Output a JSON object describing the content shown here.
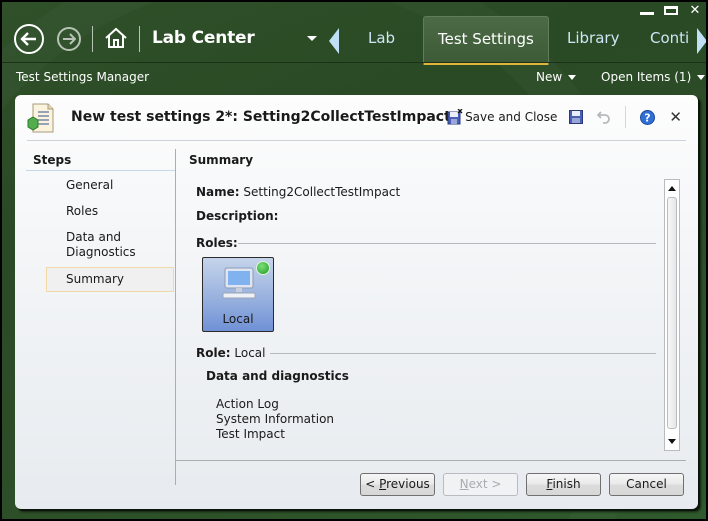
{
  "window": {
    "controls": {
      "minimize": "minimize-icon",
      "maximize": "maximize-icon",
      "close": "✕"
    }
  },
  "nav": {
    "back_icon": "back-arrow-icon",
    "forward_icon": "forward-arrow-icon",
    "home_icon": "home-icon",
    "app_title": "Lab Center",
    "tabs": [
      {
        "label": "Lab",
        "active": false
      },
      {
        "label": "Test Settings",
        "active": true
      },
      {
        "label": "Library",
        "active": false
      },
      {
        "label": "Conti",
        "active": false
      }
    ],
    "active_tab_underline_color": "#e1b53a"
  },
  "subbar": {
    "breadcrumb": "Test Settings Manager",
    "new_label": "New",
    "open_items_label": "Open Items (1)"
  },
  "dialog": {
    "title": "New test settings 2*: Setting2CollectTestImpact",
    "toolbar": {
      "save_and_close": "Save and Close",
      "save_icon": "save-icon",
      "undo_icon": "undo-icon",
      "help_icon": "help-icon",
      "close": "✕"
    },
    "steps": {
      "title": "Steps",
      "items": [
        {
          "label": "General",
          "active": false
        },
        {
          "label": "Roles",
          "active": false
        },
        {
          "label": "Data and Diagnostics",
          "active": false
        },
        {
          "label": "Summary",
          "active": true
        }
      ]
    },
    "summary": {
      "section_title": "Summary",
      "name_label": "Name:",
      "name_value": "Setting2CollectTestImpact",
      "description_label": "Description:",
      "description_value": "",
      "roles_label": "Roles:",
      "role_tiles": [
        {
          "label": "Local",
          "status": "checked"
        }
      ],
      "role_label": "Role:",
      "role_value": "Local",
      "diag_title": "Data and diagnostics",
      "diag_items": [
        "Action Log",
        "System Information",
        "Test Impact"
      ]
    },
    "buttons": {
      "previous": {
        "prefix": "< ",
        "mnemonic": "P",
        "rest": "revious",
        "enabled": true
      },
      "next": {
        "mnemonic": "N",
        "rest": "ext >",
        "enabled": false
      },
      "finish": {
        "mnemonic": "F",
        "rest": "inish",
        "enabled": true
      },
      "cancel": {
        "label": "Cancel",
        "enabled": true
      }
    }
  }
}
